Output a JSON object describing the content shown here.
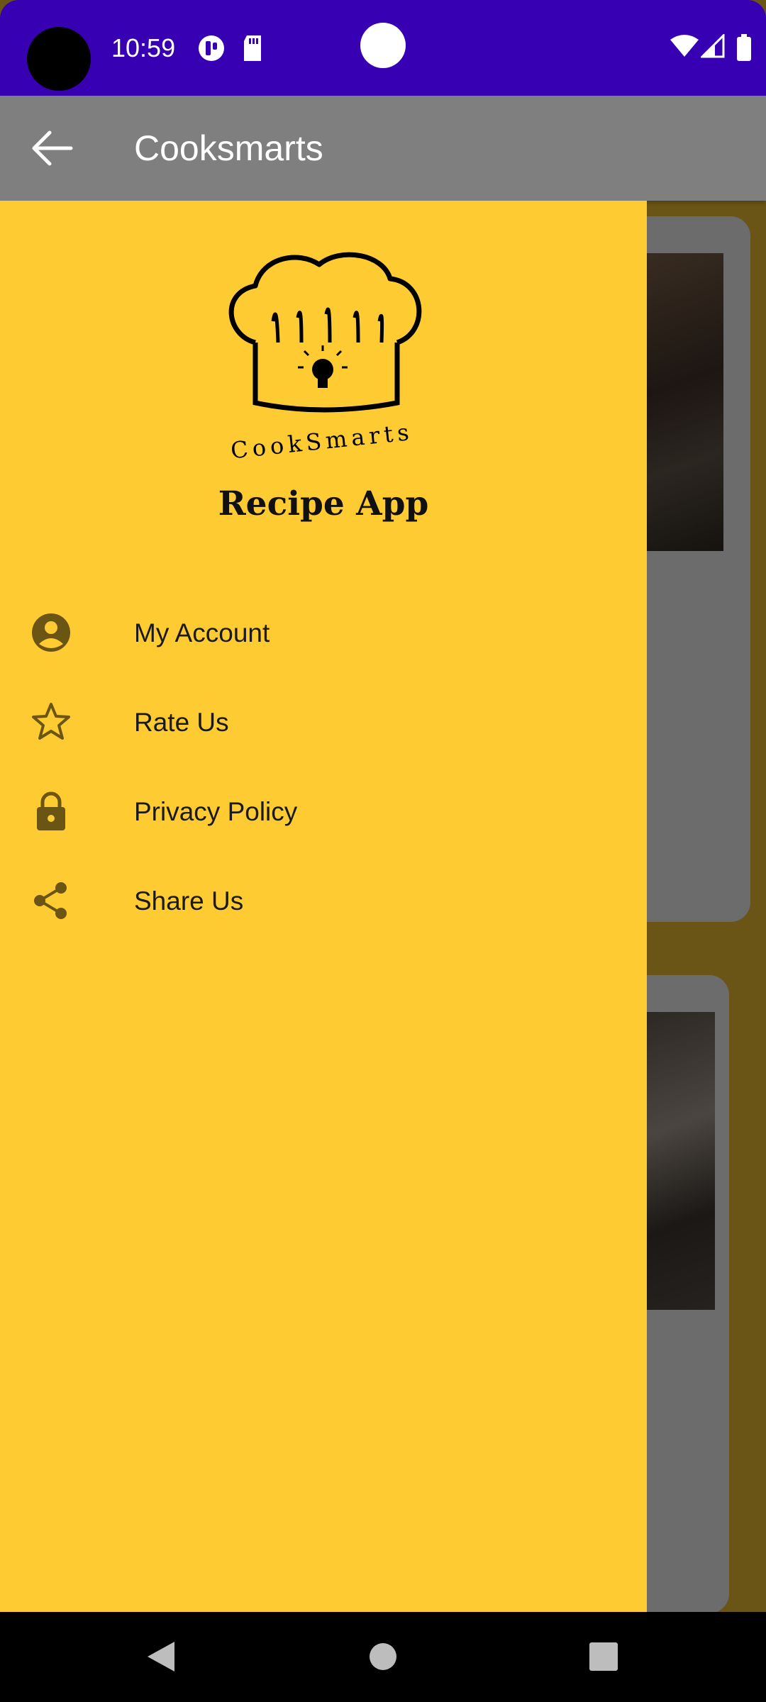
{
  "status_bar": {
    "time": "10:59"
  },
  "app_bar": {
    "title": "Cooksmarts",
    "back_icon": "arrow-back-icon"
  },
  "drawer": {
    "logo_text": "CookSmarts",
    "title": "Recipe App",
    "items": [
      {
        "label": "My Account",
        "icon": "account-circle-icon"
      },
      {
        "label": "Rate Us",
        "icon": "star-outline-icon"
      },
      {
        "label": "Privacy Policy",
        "icon": "lock-icon"
      },
      {
        "label": "Share Us",
        "icon": "share-icon"
      }
    ],
    "colors": {
      "drawer_bg": "#ffcb33",
      "icon": "#6b5514",
      "status_bar": "#3700b3"
    }
  },
  "nav_bar": {
    "buttons": [
      "back-icon",
      "home-icon",
      "recents-icon"
    ]
  }
}
